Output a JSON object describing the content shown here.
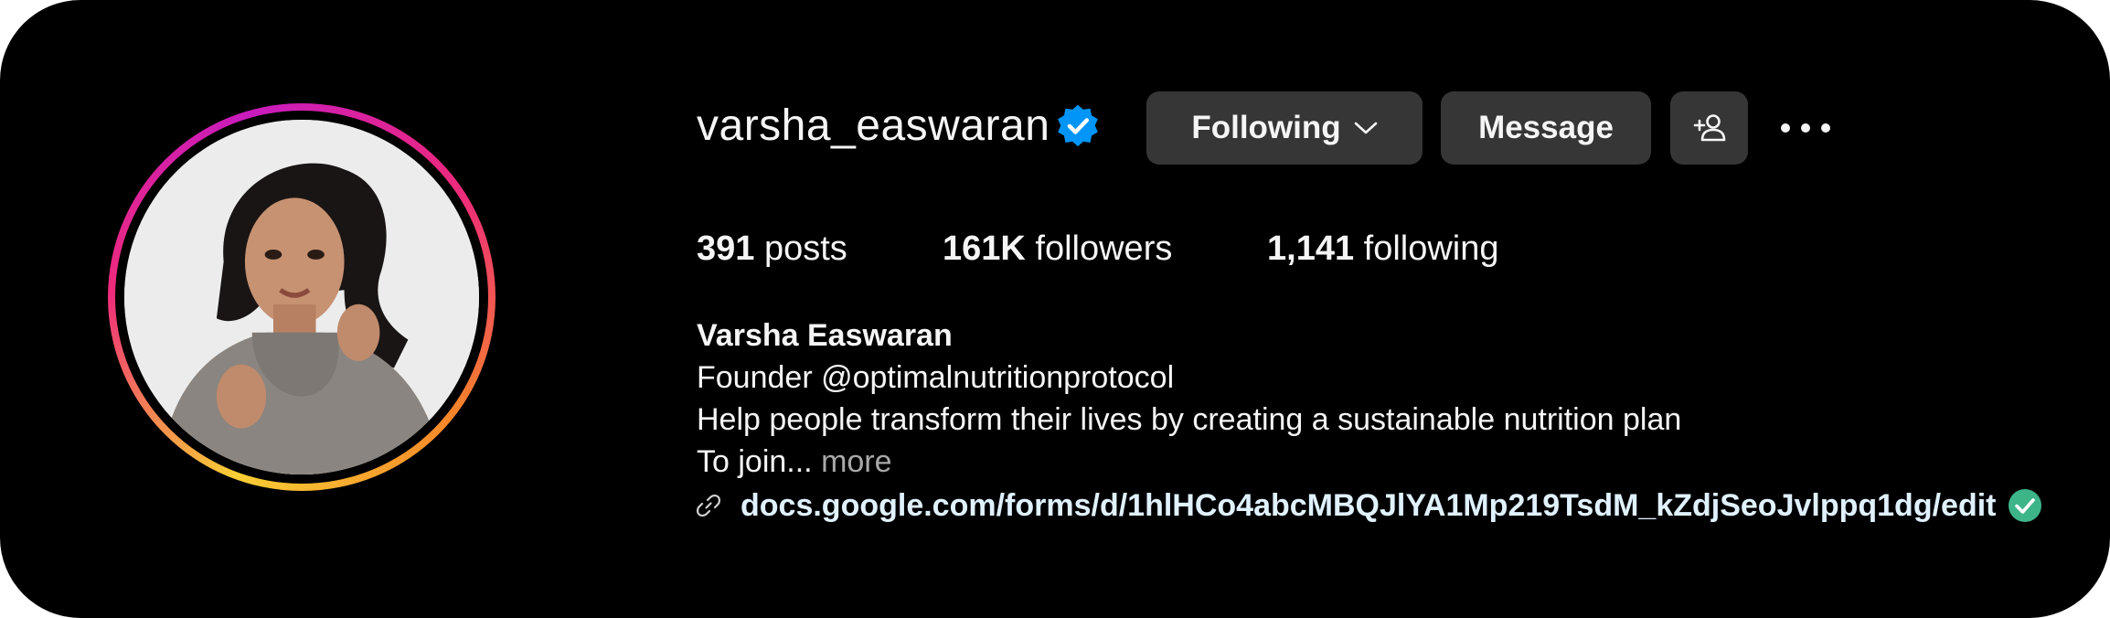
{
  "profile": {
    "username": "varsha_easwaran",
    "full_name": "Varsha Easwaran",
    "verified": true,
    "verified_color": "#0095f6"
  },
  "actions": {
    "following_label": "Following",
    "message_label": "Message",
    "add_user_icon": "add-person-icon",
    "more_icon": "ellipsis-icon"
  },
  "stats": {
    "posts_count": "391",
    "posts_label": "posts",
    "followers_count": "161K",
    "followers_label": "followers",
    "following_count": "1,141",
    "following_label": "following"
  },
  "bio": {
    "line1": "Founder @optimalnutritionprotocol",
    "line2": "Help people transform their lives by creating a sustainable nutrition plan",
    "line3": "To join...",
    "more_label": "more",
    "link": "docs.google.com/forms/d/1hlHCo4abcMBQJlYA1Mp219TsdM_kZdjSeoJvlppq1dg/edit"
  },
  "colors": {
    "background": "#000000",
    "button": "#363636",
    "text": "#f5f5f5",
    "muted": "#a8a8a8",
    "link": "#e0f1ff",
    "check": "#3eb489"
  }
}
